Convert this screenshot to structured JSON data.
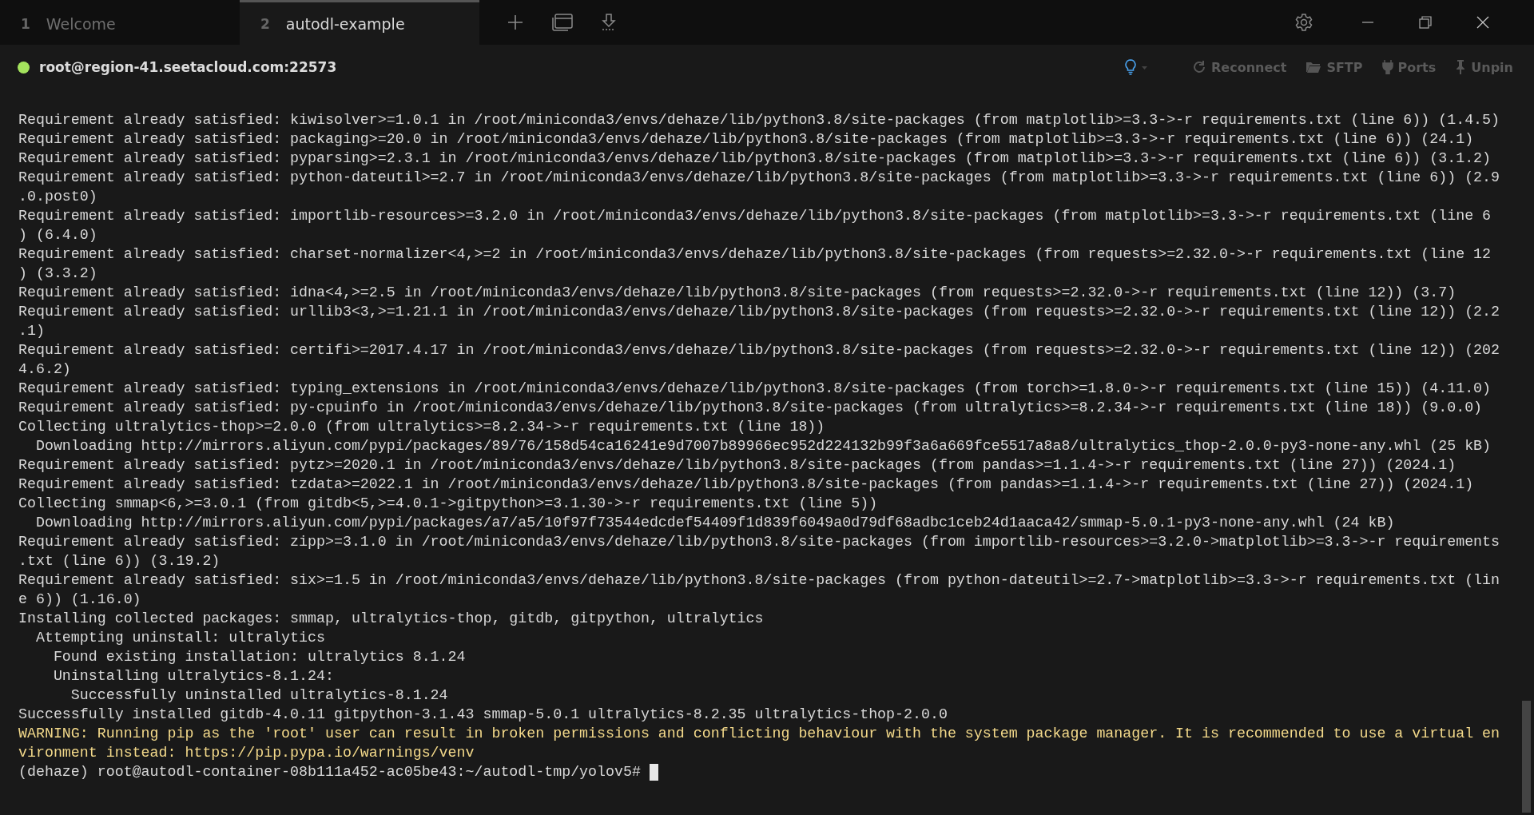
{
  "tabs": [
    {
      "number": "1",
      "label": "Welcome",
      "selected": false
    },
    {
      "number": "2",
      "label": "autodl-example",
      "selected": true
    }
  ],
  "connection": {
    "host": "root@region-41.seetacloud.com:22573",
    "connected": true
  },
  "toolbar": [
    {
      "label": "Reconnect",
      "kind": "reconnect"
    },
    {
      "label": "SFTP",
      "kind": "sftp"
    },
    {
      "label": "Ports",
      "kind": "ports"
    },
    {
      "label": "Unpin",
      "kind": "unpin"
    }
  ],
  "terminal": {
    "lines": [
      {
        "text": "Requirement already satisfied: kiwisolver>=1.0.1 in /root/miniconda3/envs/dehaze/lib/python3.8/site-packages (from matplotlib>=3.3->-r requirements.txt (line 6)) (1.4.5)",
        "kind": "output"
      },
      {
        "text": "Requirement already satisfied: packaging>=20.0 in /root/miniconda3/envs/dehaze/lib/python3.8/site-packages (from matplotlib>=3.3->-r requirements.txt (line 6)) (24.1)",
        "kind": "output"
      },
      {
        "text": "Requirement already satisfied: pyparsing>=2.3.1 in /root/miniconda3/envs/dehaze/lib/python3.8/site-packages (from matplotlib>=3.3->-r requirements.txt (line 6)) (3.1.2)",
        "kind": "output"
      },
      {
        "text": "Requirement already satisfied: python-dateutil>=2.7 in /root/miniconda3/envs/dehaze/lib/python3.8/site-packages (from matplotlib>=3.3->-r requirements.txt (line 6)) (2.9",
        "kind": "output"
      },
      {
        "text": ".0.post0)",
        "kind": "output"
      },
      {
        "text": "Requirement already satisfied: importlib-resources>=3.2.0 in /root/miniconda3/envs/dehaze/lib/python3.8/site-packages (from matplotlib>=3.3->-r requirements.txt (line 6",
        "kind": "output"
      },
      {
        "text": ") (6.4.0)",
        "kind": "output"
      },
      {
        "text": "Requirement already satisfied: charset-normalizer<4,>=2 in /root/miniconda3/envs/dehaze/lib/python3.8/site-packages (from requests>=2.32.0->-r requirements.txt (line 12",
        "kind": "output"
      },
      {
        "text": ") (3.3.2)",
        "kind": "output"
      },
      {
        "text": "Requirement already satisfied: idna<4,>=2.5 in /root/miniconda3/envs/dehaze/lib/python3.8/site-packages (from requests>=2.32.0->-r requirements.txt (line 12)) (3.7)",
        "kind": "output"
      },
      {
        "text": "Requirement already satisfied: urllib3<3,>=1.21.1 in /root/miniconda3/envs/dehaze/lib/python3.8/site-packages (from requests>=2.32.0->-r requirements.txt (line 12)) (2.2",
        "kind": "output"
      },
      {
        "text": ".1)",
        "kind": "output"
      },
      {
        "text": "Requirement already satisfied: certifi>=2017.4.17 in /root/miniconda3/envs/dehaze/lib/python3.8/site-packages (from requests>=2.32.0->-r requirements.txt (line 12)) (202",
        "kind": "output"
      },
      {
        "text": "4.6.2)",
        "kind": "output"
      },
      {
        "text": "Requirement already satisfied: typing_extensions in /root/miniconda3/envs/dehaze/lib/python3.8/site-packages (from torch>=1.8.0->-r requirements.txt (line 15)) (4.11.0)",
        "kind": "output"
      },
      {
        "text": "Requirement already satisfied: py-cpuinfo in /root/miniconda3/envs/dehaze/lib/python3.8/site-packages (from ultralytics>=8.2.34->-r requirements.txt (line 18)) (9.0.0)",
        "kind": "output"
      },
      {
        "text": "Collecting ultralytics-thop>=2.0.0 (from ultralytics>=8.2.34->-r requirements.txt (line 18))",
        "kind": "output"
      },
      {
        "text": "  Downloading http://mirrors.aliyun.com/pypi/packages/89/76/158d54ca16241e9d7007b89966ec952d224132b99f3a6a669fce5517a8a8/ultralytics_thop-2.0.0-py3-none-any.whl (25 kB)",
        "kind": "output"
      },
      {
        "text": "Requirement already satisfied: pytz>=2020.1 in /root/miniconda3/envs/dehaze/lib/python3.8/site-packages (from pandas>=1.1.4->-r requirements.txt (line 27)) (2024.1)",
        "kind": "output"
      },
      {
        "text": "Requirement already satisfied: tzdata>=2022.1 in /root/miniconda3/envs/dehaze/lib/python3.8/site-packages (from pandas>=1.1.4->-r requirements.txt (line 27)) (2024.1)",
        "kind": "output"
      },
      {
        "text": "Collecting smmap<6,>=3.0.1 (from gitdb<5,>=4.0.1->gitpython>=3.1.30->-r requirements.txt (line 5))",
        "kind": "output"
      },
      {
        "text": "  Downloading http://mirrors.aliyun.com/pypi/packages/a7/a5/10f97f73544edcdef54409f1d839f6049a0d79df68adbc1ceb24d1aaca42/smmap-5.0.1-py3-none-any.whl (24 kB)",
        "kind": "output"
      },
      {
        "text": "Requirement already satisfied: zipp>=3.1.0 in /root/miniconda3/envs/dehaze/lib/python3.8/site-packages (from importlib-resources>=3.2.0->matplotlib>=3.3->-r requirements",
        "kind": "output"
      },
      {
        "text": ".txt (line 6)) (3.19.2)",
        "kind": "output"
      },
      {
        "text": "Requirement already satisfied: six>=1.5 in /root/miniconda3/envs/dehaze/lib/python3.8/site-packages (from python-dateutil>=2.7->matplotlib>=3.3->-r requirements.txt (lin",
        "kind": "output"
      },
      {
        "text": "e 6)) (1.16.0)",
        "kind": "output"
      },
      {
        "text": "Installing collected packages: smmap, ultralytics-thop, gitdb, gitpython, ultralytics",
        "kind": "output"
      },
      {
        "text": "  Attempting uninstall: ultralytics",
        "kind": "output"
      },
      {
        "text": "    Found existing installation: ultralytics 8.1.24",
        "kind": "output"
      },
      {
        "text": "    Uninstalling ultralytics-8.1.24:",
        "kind": "output"
      },
      {
        "text": "      Successfully uninstalled ultralytics-8.1.24",
        "kind": "output"
      },
      {
        "text": "Successfully installed gitdb-4.0.11 gitpython-3.1.43 smmap-5.0.1 ultralytics-8.2.35 ultralytics-thop-2.0.0",
        "kind": "output"
      },
      {
        "text": "WARNING: Running pip as the 'root' user can result in broken permissions and conflicting behaviour with the system package manager. It is recommended to use a virtual en",
        "kind": "warning"
      },
      {
        "text": "vironment instead: https://pip.pypa.io/warnings/venv",
        "kind": "warning"
      },
      {
        "text": "(dehaze) root@autodl-container-08b111a452-ac05be43:~/autodl-tmp/yolov5# ",
        "kind": "prompt"
      }
    ]
  }
}
